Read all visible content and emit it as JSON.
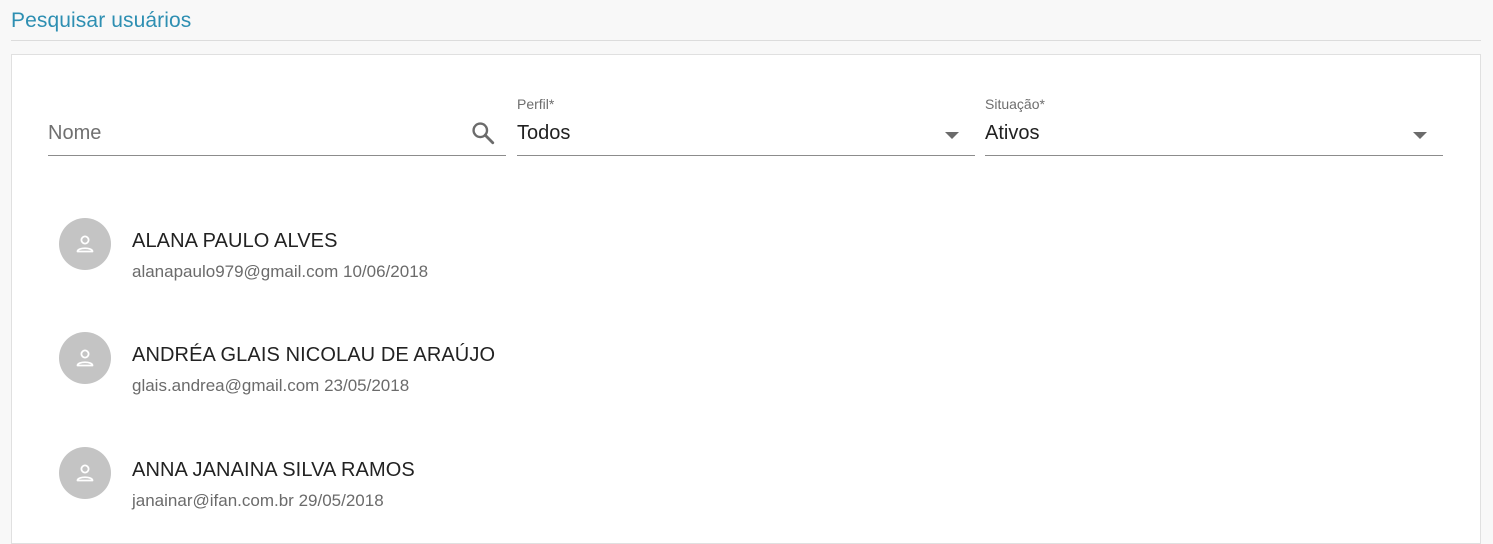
{
  "header": {
    "title": "Pesquisar usuários"
  },
  "filters": {
    "name": {
      "placeholder": "Nome",
      "value": ""
    },
    "profile": {
      "label": "Perfil*",
      "value": "Todos"
    },
    "status": {
      "label": "Situação*",
      "value": "Ativos"
    }
  },
  "icons": {
    "search": "search-icon",
    "dropdown": "chevron-down-icon",
    "avatar": "person-icon"
  },
  "users": [
    {
      "name": "ALANA PAULO ALVES",
      "email": "alanapaulo979@gmail.com",
      "date": "10/06/2018"
    },
    {
      "name": "ANDRÉA GLAIS NICOLAU DE ARAÚJO",
      "email": "glais.andrea@gmail.com",
      "date": "23/05/2018"
    },
    {
      "name": "ANNA JANAINA SILVA RAMOS",
      "email": "janainar@ifan.com.br",
      "date": "29/05/2018"
    }
  ],
  "colors": {
    "accent": "#2e8fb2",
    "avatar_bg": "#c4c4c4"
  }
}
